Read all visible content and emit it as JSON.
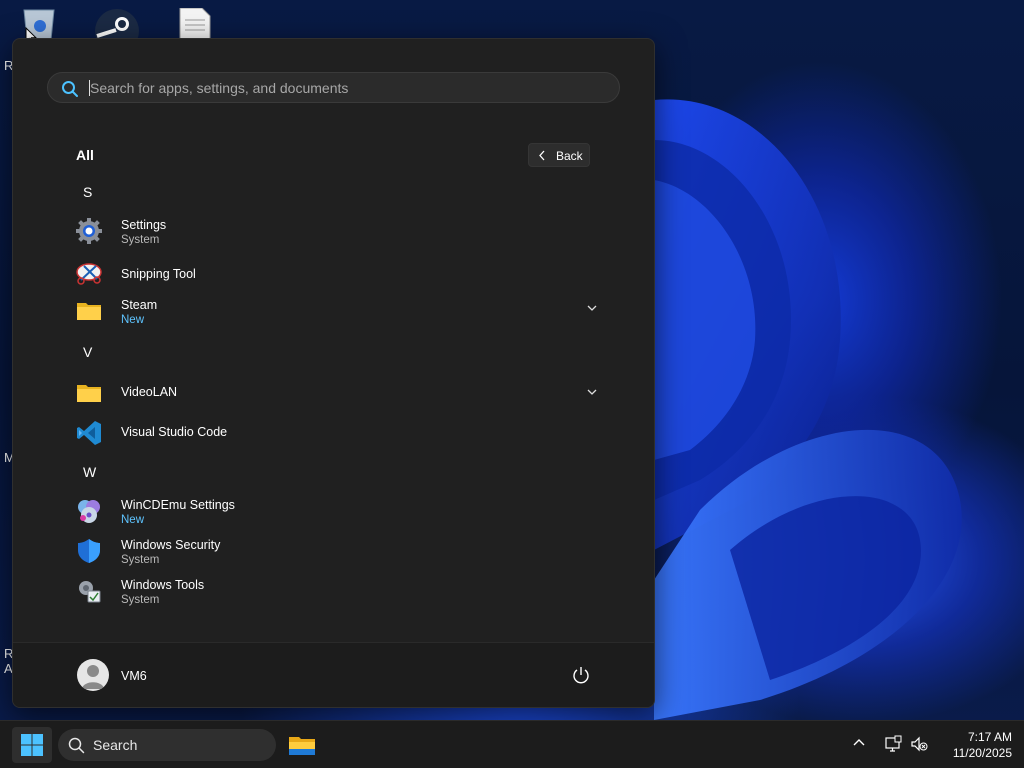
{
  "desktop": {
    "edge_texts": [
      "R",
      "M",
      "Ri",
      "A"
    ]
  },
  "start_menu": {
    "search": {
      "placeholder": "Search for apps, settings, and documents",
      "value": ""
    },
    "all_label": "All",
    "back_label": "Back",
    "sections": [
      {
        "letter": "S"
      },
      {
        "letter": "V"
      },
      {
        "letter": "W"
      }
    ],
    "apps": [
      {
        "name": "Settings",
        "subtitle": "System",
        "icon": "settings-gear-icon"
      },
      {
        "name": "Snipping Tool",
        "subtitle": "",
        "icon": "snipping-tool-icon"
      },
      {
        "name": "Steam",
        "subtitle": "New",
        "icon": "folder-icon",
        "expandable": true
      },
      {
        "name": "VideoLAN",
        "subtitle": "",
        "icon": "folder-icon",
        "expandable": true
      },
      {
        "name": "Visual Studio Code",
        "subtitle": "",
        "icon": "vscode-icon"
      },
      {
        "name": "WinCDEmu Settings",
        "subtitle": "New",
        "icon": "wincdemu-icon"
      },
      {
        "name": "Windows Security",
        "subtitle": "System",
        "icon": "shield-icon"
      },
      {
        "name": "Windows Tools",
        "subtitle": "System",
        "icon": "windows-tools-icon"
      }
    ],
    "user": {
      "name": "VM6"
    }
  },
  "taskbar": {
    "search_label": "Search",
    "time": "7:17 AM",
    "date": "11/20/2025"
  },
  "colors": {
    "menu_bg": "#202020",
    "accent_new": "#5ec4ff",
    "taskbar_bg": "#1c1c1c"
  }
}
